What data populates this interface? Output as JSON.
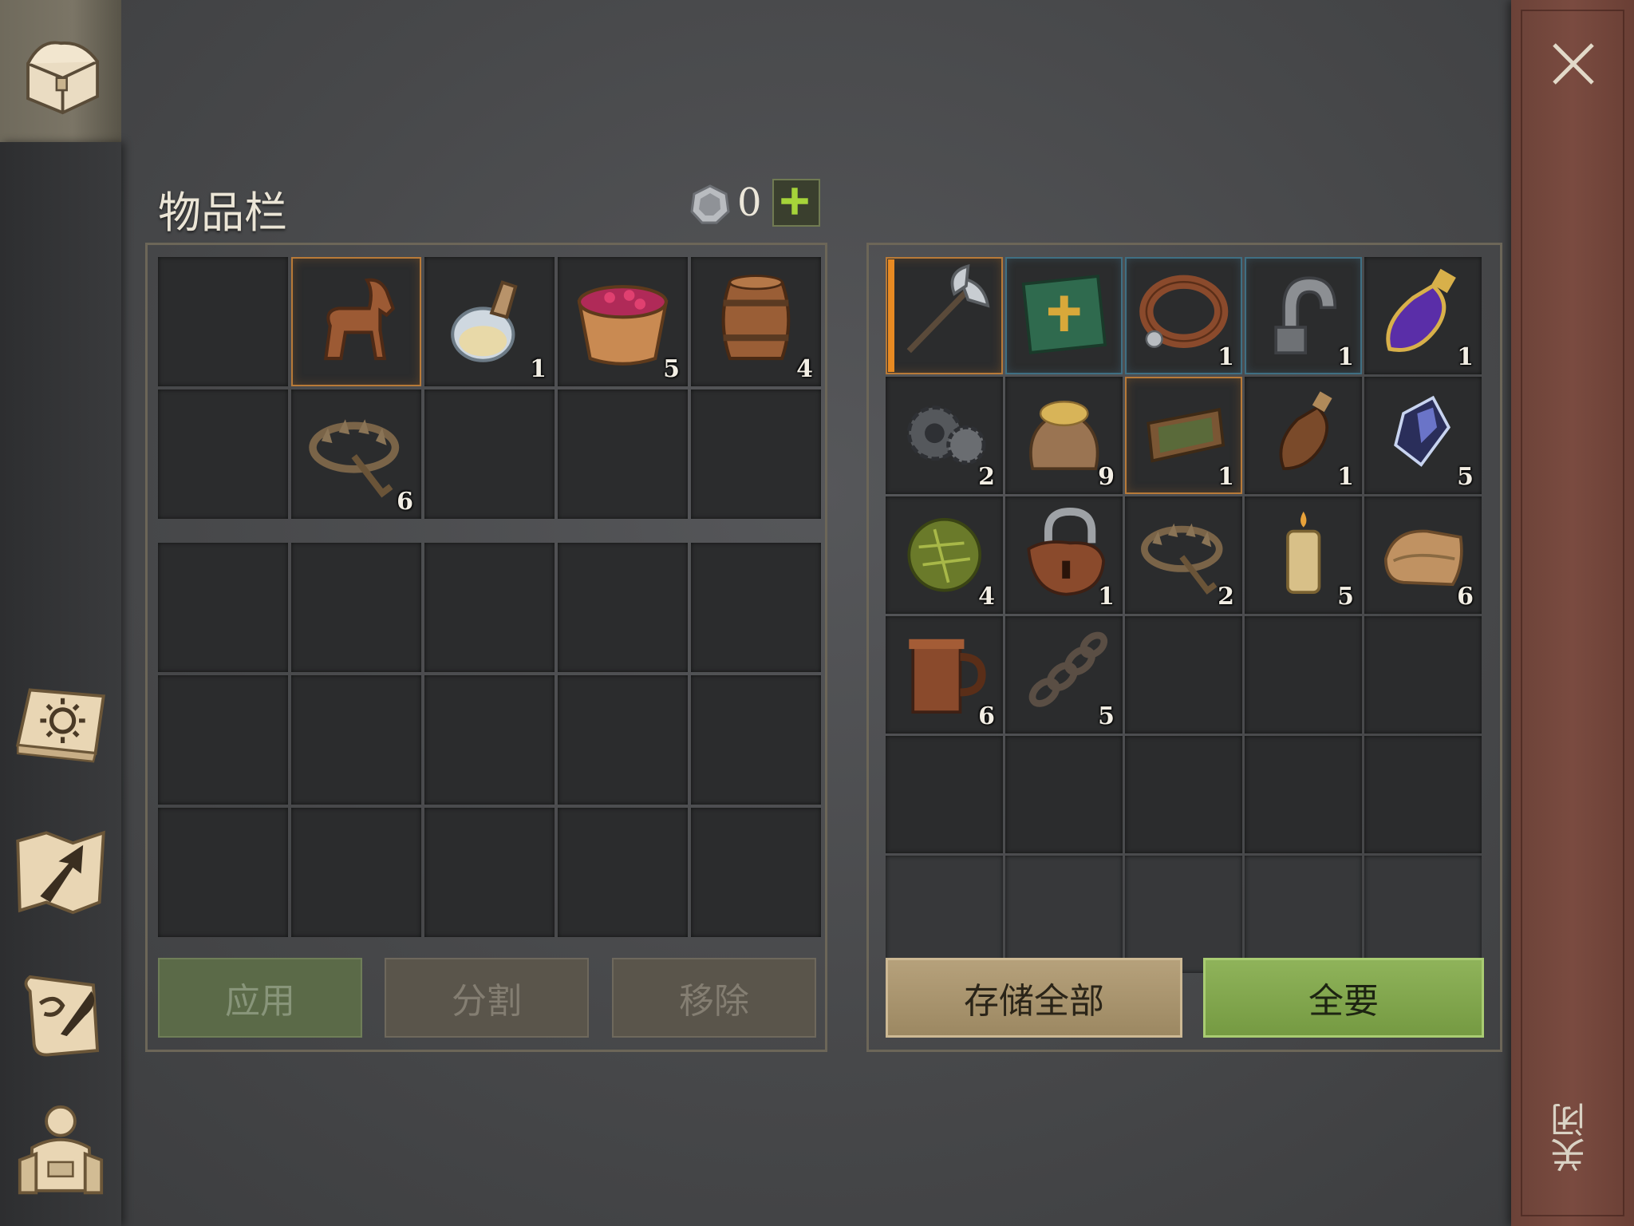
{
  "inventory": {
    "title": "物品栏",
    "currency": {
      "icon": "silver-coin-icon",
      "count": "0",
      "add_icon": "plus-icon"
    },
    "buttons": {
      "apply": "应用",
      "split": "分割",
      "remove": "移除"
    },
    "slots": [
      {
        "icon": "",
        "qty": ""
      },
      {
        "icon": "wooden-horse-icon",
        "qty": "",
        "selected": true
      },
      {
        "icon": "potion-flask-icon",
        "qty": "1"
      },
      {
        "icon": "berry-bucket-icon",
        "qty": "5"
      },
      {
        "icon": "barrel-icon",
        "qty": "4"
      },
      {
        "icon": "",
        "qty": ""
      },
      {
        "icon": "bear-trap-icon",
        "qty": "6"
      }
    ],
    "backpack_rows": 3
  },
  "storage": {
    "buttons": {
      "store_all": "存储全部",
      "take_all": "全要"
    },
    "slots": [
      {
        "icon": "battle-axe-icon",
        "qty": "",
        "rarity": "orange"
      },
      {
        "icon": "green-book-icon",
        "qty": "",
        "rarity": "blue"
      },
      {
        "icon": "leather-collar-icon",
        "qty": "1",
        "rarity": "blue"
      },
      {
        "icon": "iron-shackle-icon",
        "qty": "1",
        "rarity": "blue"
      },
      {
        "icon": "purple-elixir-icon",
        "qty": "1"
      },
      {
        "icon": "gears-icon",
        "qty": "2"
      },
      {
        "icon": "grain-sack-icon",
        "qty": "9"
      },
      {
        "icon": "wooden-tray-icon",
        "qty": "1",
        "rarity": "orange"
      },
      {
        "icon": "leather-flask-icon",
        "qty": "1"
      },
      {
        "icon": "crystal-icon",
        "qty": "5"
      },
      {
        "icon": "herb-ball-icon",
        "qty": "4"
      },
      {
        "icon": "padlock-icon",
        "qty": "1"
      },
      {
        "icon": "bear-trap-icon",
        "qty": "2"
      },
      {
        "icon": "candle-icon",
        "qty": "5"
      },
      {
        "icon": "cloth-icon",
        "qty": "6"
      },
      {
        "icon": "tankard-icon",
        "qty": "6"
      },
      {
        "icon": "chain-icon",
        "qty": "5"
      }
    ]
  },
  "sidebar": {
    "items": [
      {
        "icon": "chest-icon",
        "active": true
      },
      {
        "icon": "sun-book-icon"
      },
      {
        "icon": "map-arrow-icon"
      },
      {
        "icon": "scroll-quill-icon"
      },
      {
        "icon": "character-backpack-icon"
      }
    ]
  },
  "close": {
    "label": "关闭",
    "icon": "close-icon"
  },
  "colors": {
    "rarity_orange": "#e88a22",
    "rarity_blue": "#3f6f83",
    "take_all_green": "#8fb35a",
    "store_all_tan": "#b6a17b"
  }
}
